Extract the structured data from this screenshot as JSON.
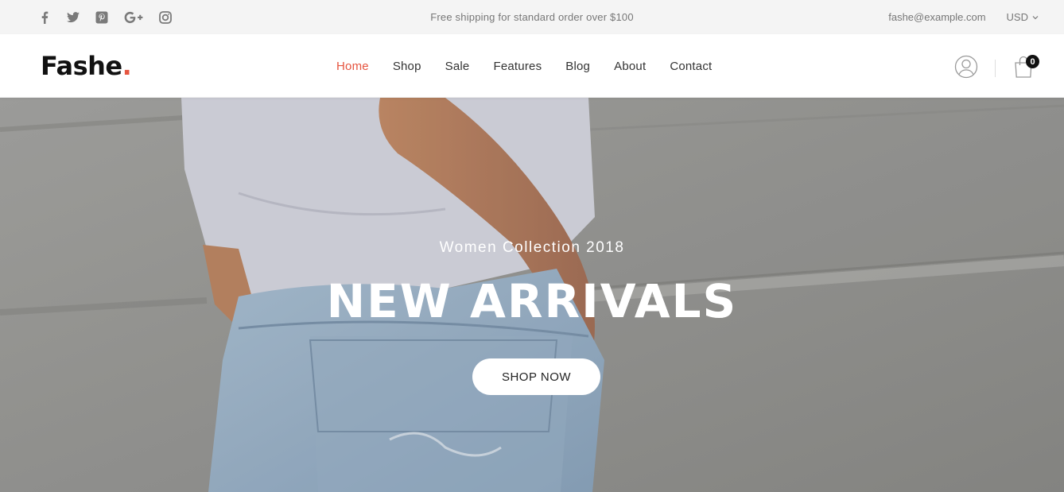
{
  "topbar": {
    "social": [
      {
        "icon": "facebook-icon"
      },
      {
        "icon": "twitter-icon"
      },
      {
        "icon": "pinterest-icon"
      },
      {
        "icon": "google-plus-icon"
      },
      {
        "icon": "instagram-icon"
      }
    ],
    "promo": "Free shipping for standard order over $100",
    "email": "fashe@example.com",
    "currency": "USD"
  },
  "header": {
    "logo_text": "Fashe",
    "logo_dot": ".",
    "nav": [
      {
        "label": "Home",
        "active": true
      },
      {
        "label": "Shop"
      },
      {
        "label": "Sale"
      },
      {
        "label": "Features"
      },
      {
        "label": "Blog"
      },
      {
        "label": "About"
      },
      {
        "label": "Contact"
      }
    ],
    "cart_count": "0"
  },
  "hero": {
    "subtitle": "Women Collection 2018",
    "title": "NEW ARRIVALS",
    "button": "SHOP NOW"
  },
  "colors": {
    "accent": "#e65540",
    "topbar_bg": "#f4f4f4",
    "text_dark": "#333333"
  }
}
